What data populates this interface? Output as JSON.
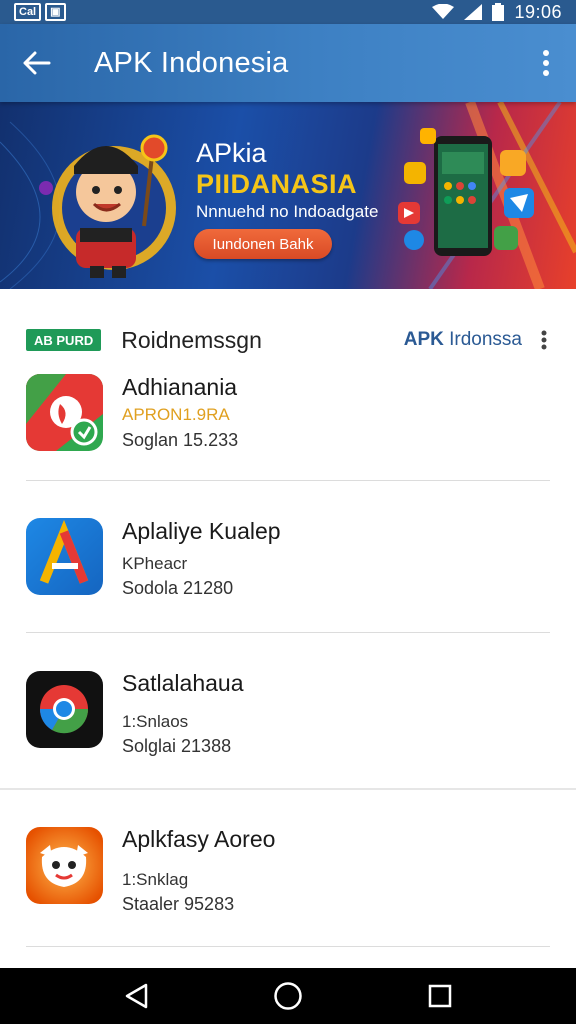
{
  "status_bar": {
    "left_text": "Cal",
    "time": "19:06"
  },
  "app_bar": {
    "title": "APK Indonesia"
  },
  "banner": {
    "heading1": "APkia",
    "heading2": "PIIDANASIA",
    "subtitle": "Nnnuehd no Indoadgate",
    "cta_label": "Iundonen Bahk",
    "colors": {
      "accent": "#f5c518",
      "cta": "#e3552d"
    }
  },
  "section": {
    "badge": "AB PURD",
    "title": "Roidnemssgn",
    "brand_prefix": "APK",
    "brand_suffix": " Irdonssa"
  },
  "apps": [
    {
      "name": "Adhianania",
      "line1": "APRON1.9RA",
      "line2": "Soglan 15.233",
      "icon": "green-red-app-icon"
    },
    {
      "name": "Aplaliye Kualep",
      "line1": "KPheacr",
      "line2": "Sodola 21280",
      "icon": "blue-a-app-icon"
    },
    {
      "name": "Satlalahaua",
      "line1": "1:Snlaos",
      "line2": "Solglai 21388",
      "icon": "chrome-like-app-icon"
    },
    {
      "name": "Aplkfasy Aoreo",
      "line1": "1:Snklag",
      "line2": "Staaler 95283",
      "icon": "orange-mascot-app-icon"
    }
  ]
}
